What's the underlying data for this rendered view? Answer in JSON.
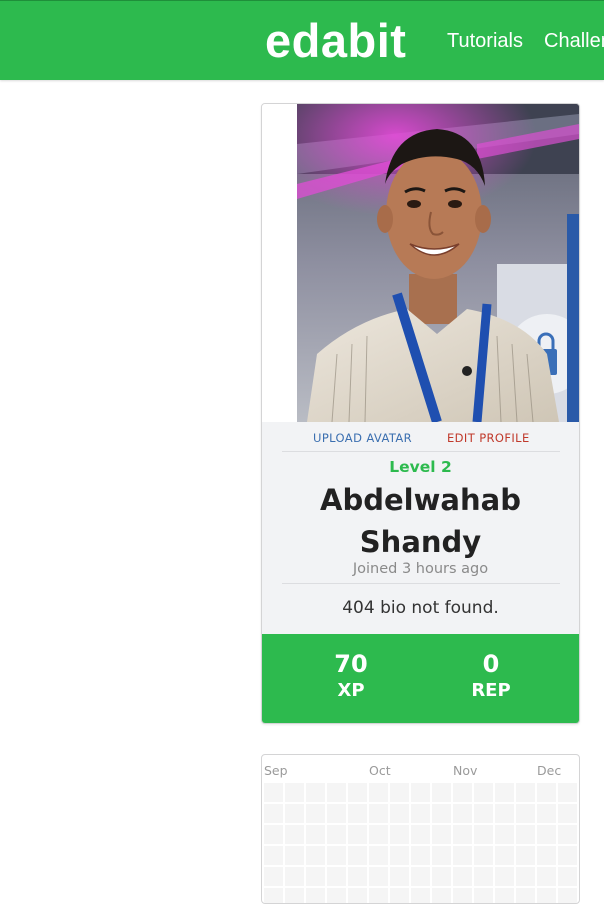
{
  "header": {
    "brand": "edabit",
    "nav": [
      {
        "label": "Tutorials"
      },
      {
        "label": "Challenges"
      }
    ]
  },
  "profile": {
    "actions": {
      "upload_avatar": "UPLOAD AVATAR",
      "edit_profile": "EDIT PROFILE"
    },
    "level": "Level 2",
    "name": "Abdelwahab Shandy",
    "joined": "Joined 3 hours ago",
    "bio": "404 bio not found.",
    "stats": {
      "xp": {
        "value": "70",
        "label": "XP"
      },
      "rep": {
        "value": "0",
        "label": "REP"
      }
    }
  },
  "activity": {
    "months": [
      "Sep",
      "Oct",
      "Nov",
      "Dec"
    ]
  },
  "colors": {
    "brand_green": "#2dba4e",
    "upload_link": "#3b6fb0",
    "edit_link": "#c0392b",
    "heatmap_empty": "#f5f5f5"
  }
}
